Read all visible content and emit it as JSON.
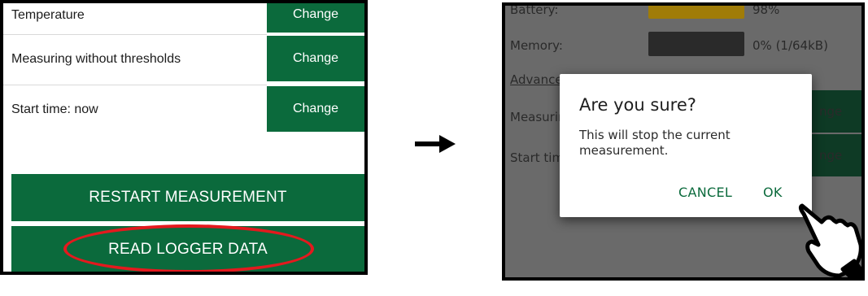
{
  "left": {
    "rows": [
      {
        "label": "Temperature",
        "button": "Change"
      },
      {
        "label": "Measuring without thresholds",
        "button": "Change"
      },
      {
        "label": "Start time: now",
        "button": "Change"
      }
    ],
    "restart_label": "RESTART MEASUREMENT",
    "read_label": "READ LOGGER DATA",
    "highlight_color": "#e4191e",
    "accent": "#0b6a3c"
  },
  "right": {
    "battery_label": "Battery:",
    "battery_value": "98%",
    "battery_color": "#c99a00",
    "memory_label": "Memory:",
    "memory_value": "0% (1/64kB)",
    "advanced_label": "Advance",
    "measuring_label": "Measurin",
    "start_label": "Start tim",
    "change_partial": "nge",
    "dialog": {
      "title": "Are you sure?",
      "message": "This will stop the current measurement.",
      "cancel": "CANCEL",
      "ok": "OK"
    }
  }
}
